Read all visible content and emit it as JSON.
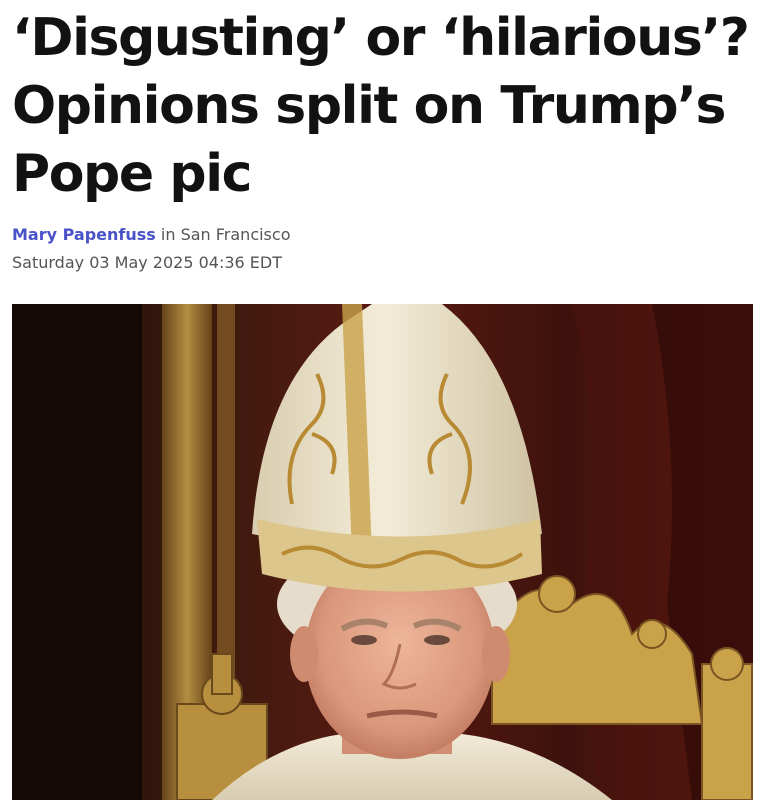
{
  "article": {
    "headline_line1": "‘Disgusting’ or ‘hilarious’?",
    "headline_line2": "Opinions split on Trump’s",
    "headline_line3": "Pope pic",
    "author": "Mary Papenfuss",
    "location_prefix": " in ",
    "location": "San Francisco",
    "dateline": "Saturday 03 May 2025 04:36 EDT"
  },
  "image": {
    "subject": "pope-portrait",
    "colors": {
      "background_dark": "#2a140b",
      "curtain_red": "#5a1a12",
      "gold": "#c9a24a",
      "mitre_cream": "#efe6cf",
      "skin": "#e2a58a"
    }
  }
}
